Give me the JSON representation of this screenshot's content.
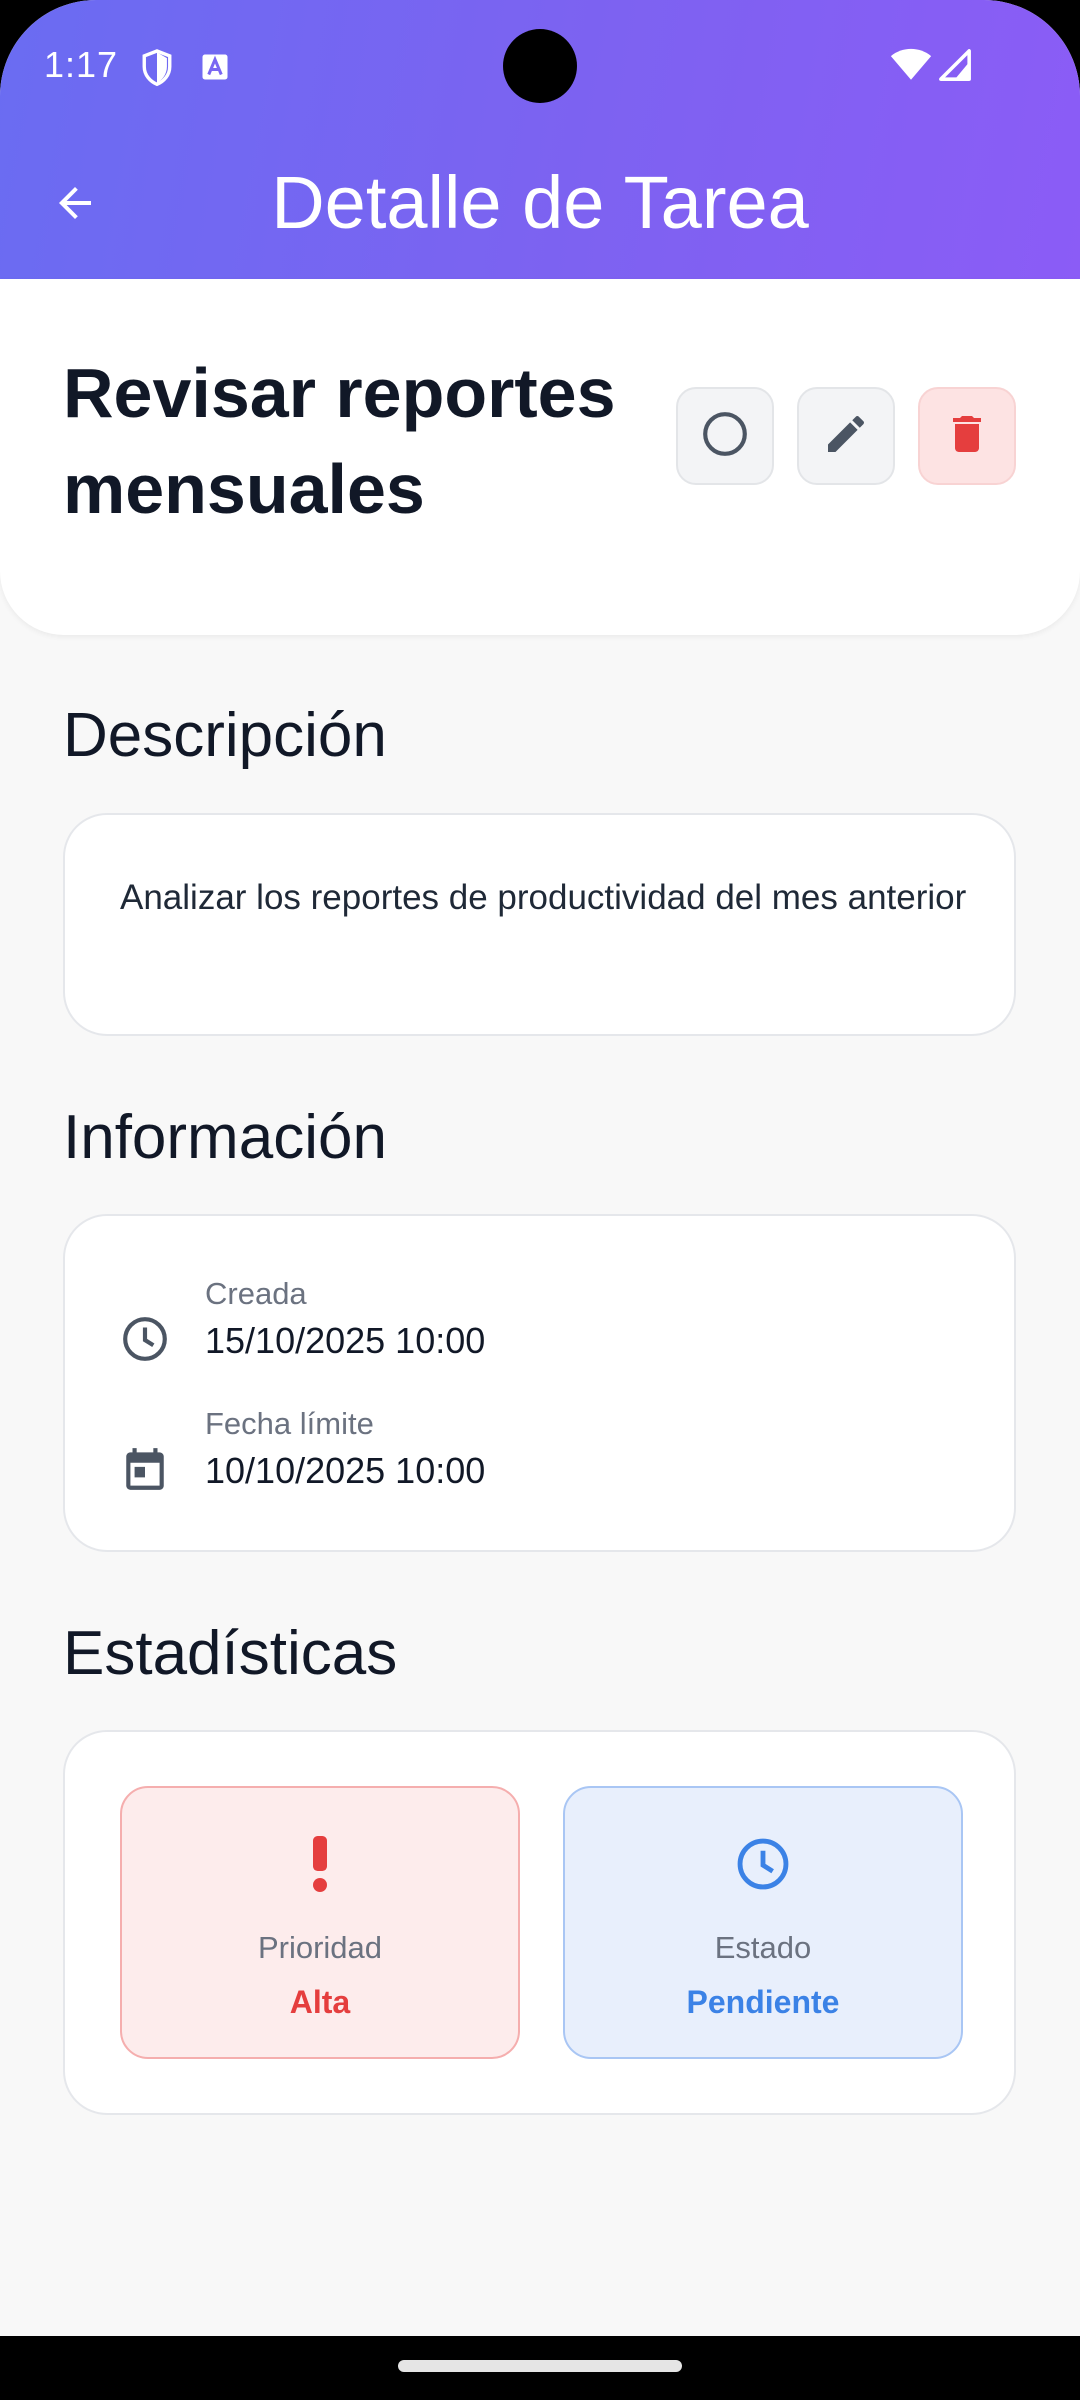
{
  "status_bar": {
    "time": "1:17"
  },
  "app_bar": {
    "title": "Detalle de Tarea"
  },
  "task": {
    "title": "Revisar reportes mensuales"
  },
  "description": {
    "heading": "Descripción",
    "text": "Analizar los reportes de productividad del mes anterior"
  },
  "info": {
    "heading": "Información",
    "created_label": "Creada",
    "created_value": "15/10/2025 10:00",
    "due_label": "Fecha límite",
    "due_value": "10/10/2025 10:00"
  },
  "stats": {
    "heading": "Estadísticas",
    "priority_label": "Prioridad",
    "priority_value": "Alta",
    "status_label": "Estado",
    "status_value": "Pendiente"
  },
  "colors": {
    "header_gradient_start": "#6a6cf2",
    "header_gradient_end": "#8b5cf6",
    "priority_red": "#e53e3e",
    "status_blue": "#3b82e6",
    "delete_bg": "#fde3e3"
  },
  "icons": {
    "back": "arrow-back-icon",
    "toggle_complete": "circle-outline-icon",
    "edit": "pencil-icon",
    "delete": "trash-icon",
    "created": "clock-icon",
    "due": "calendar-icon",
    "priority": "exclamation-icon",
    "status": "clock-icon"
  }
}
